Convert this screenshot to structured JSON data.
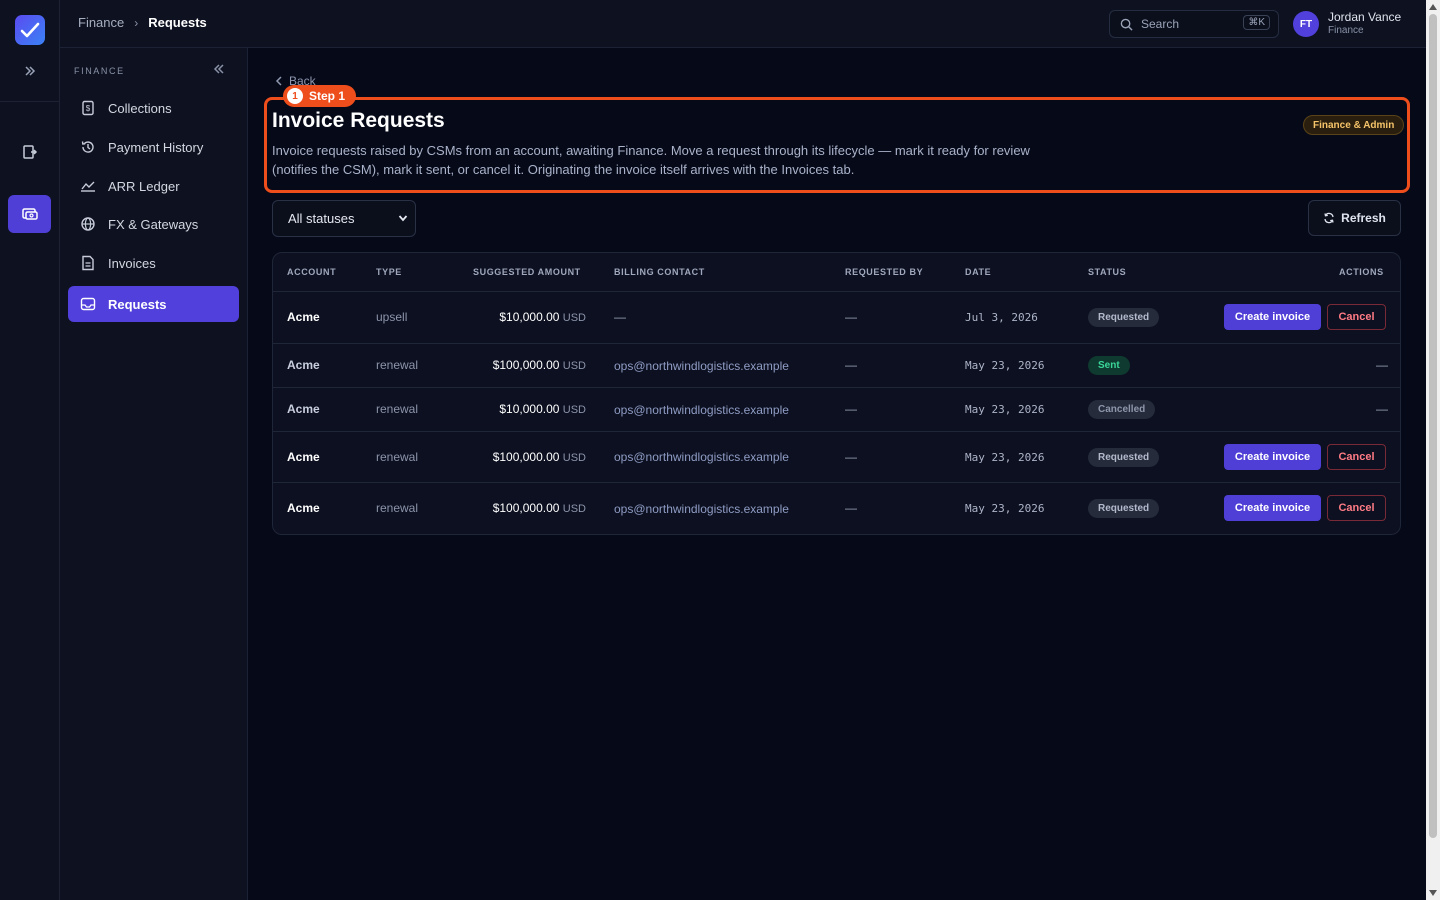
{
  "topbar": {
    "crumb_parent": "Finance",
    "crumb_current": "Requests",
    "search_placeholder": "Search",
    "search_kbd": "⌘K",
    "user_initials": "FT",
    "user_name": "Jordan Vance",
    "user_role": "Finance"
  },
  "sidebar": {
    "section": "FINANCE",
    "items": [
      {
        "label": "Collections",
        "icon": "receipt-icon"
      },
      {
        "label": "Payment History",
        "icon": "history-icon"
      },
      {
        "label": "ARR Ledger",
        "icon": "chart-line-icon"
      },
      {
        "label": "FX & Gateways",
        "icon": "globe-icon"
      },
      {
        "label": "Invoices",
        "icon": "document-icon"
      },
      {
        "label": "Requests",
        "icon": "inbox-icon"
      }
    ],
    "active": "Requests"
  },
  "page": {
    "back_label": "Back",
    "step_number": "1",
    "step_label": "Step 1",
    "title": "Invoice Requests",
    "description": "Invoice requests raised by CSMs from an account, awaiting Finance. Move a request through its lifecycle — mark it ready for review (notifies the CSM), mark it sent, or cancel it. Originating the invoice itself arrives with the Invoices tab.",
    "role_badge": "Finance & Admin"
  },
  "filters": {
    "status_value": "All statuses",
    "refresh_label": "Refresh"
  },
  "table": {
    "columns": [
      "ACCOUNT",
      "TYPE",
      "SUGGESTED AMOUNT",
      "BILLING CONTACT",
      "REQUESTED BY",
      "DATE",
      "STATUS",
      "ACTIONS"
    ],
    "rows": [
      {
        "account": "Acme",
        "type": "upsell",
        "amount": "$10,000.00",
        "currency": "USD",
        "contact": "—",
        "requested_by": "—",
        "date": "Jul 3, 2026",
        "status": "Requested",
        "create": "Create invoice",
        "cancel": "Cancel"
      },
      {
        "account": "Acme",
        "type": "renewal",
        "amount": "$100,000.00",
        "currency": "USD",
        "contact": "ops@northwindlogistics.example",
        "requested_by": "—",
        "date": "May 23, 2026",
        "status": "Sent",
        "actions_empty": "—"
      },
      {
        "account": "Acme",
        "type": "renewal",
        "amount": "$10,000.00",
        "currency": "USD",
        "contact": "ops@northwindlogistics.example",
        "requested_by": "—",
        "date": "May 23, 2026",
        "status": "Cancelled",
        "actions_empty": "—"
      },
      {
        "account": "Acme",
        "type": "renewal",
        "amount": "$100,000.00",
        "currency": "USD",
        "contact": "ops@northwindlogistics.example",
        "requested_by": "—",
        "date": "May 23, 2026",
        "status": "Requested",
        "create": "Create invoice",
        "cancel": "Cancel"
      },
      {
        "account": "Acme",
        "type": "renewal",
        "amount": "$100,000.00",
        "currency": "USD",
        "contact": "ops@northwindlogistics.example",
        "requested_by": "—",
        "date": "May 23, 2026",
        "status": "Requested",
        "create": "Create invoice",
        "cancel": "Cancel"
      }
    ]
  },
  "colors": {
    "accent": "#5140db",
    "highlight": "#ee4d1c",
    "sent": "#3ad69a",
    "danger": "#ff7b85"
  }
}
